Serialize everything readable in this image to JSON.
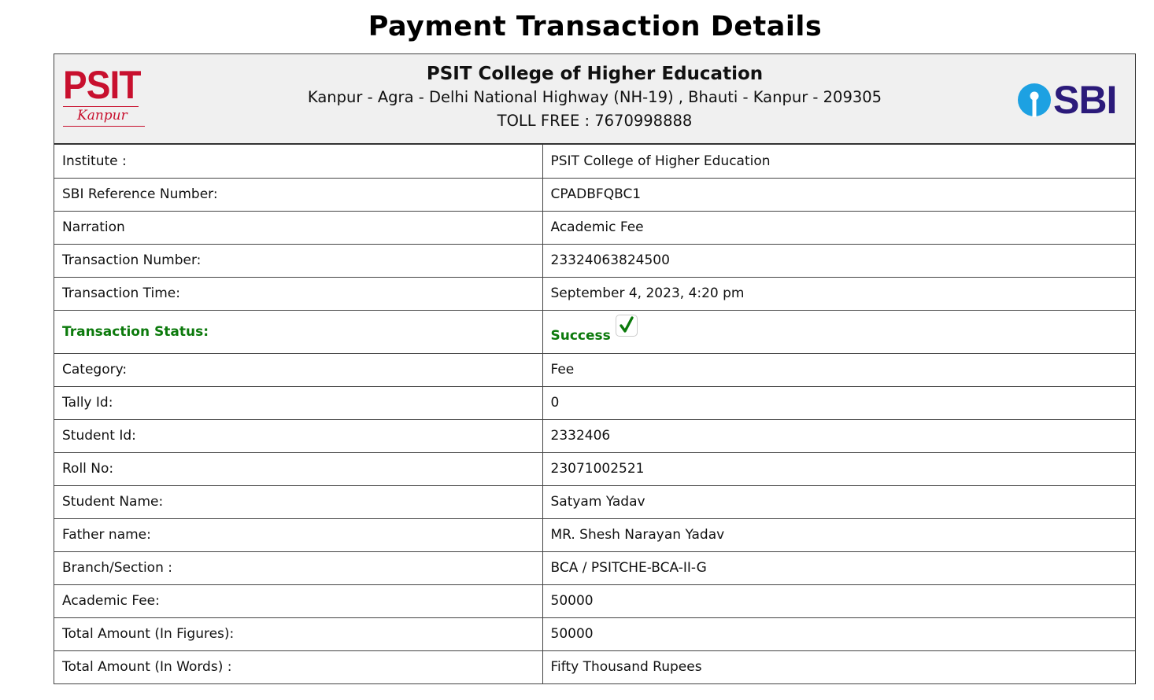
{
  "page": {
    "title": "Payment Transaction Details"
  },
  "header": {
    "psit_logo": {
      "word": "PSIT",
      "subword": "Kanpur"
    },
    "institution_name": "PSIT College of Higher Education",
    "address": "Kanpur - Agra - Delhi National Highway (NH-19) , Bhauti - Kanpur - 209305",
    "toll_free": "TOLL FREE : 7670998888",
    "sbi_logo": {
      "word": "SBI",
      "icon": "sbi-keyhole-icon"
    }
  },
  "colors": {
    "psit_red": "#c8102e",
    "sbi_blue": "#1da1e2",
    "sbi_navy": "#2b1a7a",
    "success_green": "#0c7a0c",
    "header_bg": "#f0f0f0"
  },
  "details": {
    "institute": {
      "label": "Institute :",
      "value": "PSIT College of Higher Education"
    },
    "sbi_reference": {
      "label": "SBI Reference Number:",
      "value": "CPADBFQBC1"
    },
    "narration": {
      "label": "Narration",
      "value": "Academic Fee"
    },
    "transaction_number": {
      "label": "Transaction Number:",
      "value": "23324063824500"
    },
    "transaction_time": {
      "label": "Transaction Time:",
      "value": "September 4, 2023, 4:20 pm"
    },
    "transaction_status": {
      "label": "Transaction Status:",
      "value": "Success",
      "icon": "check-icon"
    },
    "category": {
      "label": "Category:",
      "value": "Fee"
    },
    "tally_id": {
      "label": "Tally Id:",
      "value": "0"
    },
    "student_id": {
      "label": "Student Id:",
      "value": "2332406"
    },
    "roll_no": {
      "label": "Roll No:",
      "value": "23071002521"
    },
    "student_name": {
      "label": "Student Name:",
      "value": "Satyam Yadav"
    },
    "father_name": {
      "label": "Father name:",
      "value": "MR. Shesh Narayan Yadav"
    },
    "branch_section": {
      "label": "Branch/Section :",
      "value": "BCA / PSITCHE-BCA-II-G"
    },
    "academic_fee": {
      "label": "Academic Fee:",
      "value": "50000"
    },
    "total_figures": {
      "label": "Total Amount (In Figures):",
      "value": "50000"
    },
    "total_words": {
      "label": "Total Amount (In Words) :",
      "value": "Fifty Thousand Rupees"
    }
  }
}
